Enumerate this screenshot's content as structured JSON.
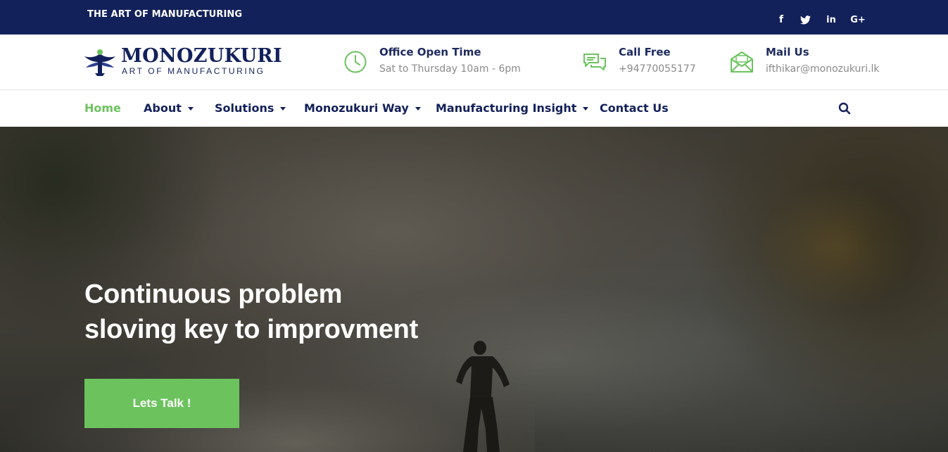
{
  "topbar": {
    "title": "THE ART OF MANUFACTURING",
    "social": [
      {
        "icon": "facebook-icon",
        "glyph": "f"
      },
      {
        "icon": "twitter-icon",
        "glyph": ""
      },
      {
        "icon": "linkedin-icon",
        "glyph": "in"
      },
      {
        "icon": "google-plus-icon",
        "glyph": "G+"
      }
    ]
  },
  "logo": {
    "name": "MONOZUKURI",
    "tagline": "ART OF MANUFACTURING"
  },
  "info": {
    "office": {
      "title": "Office Open Time",
      "sub": "Sat to Thursday 10am - 6pm",
      "icon": "clock-icon"
    },
    "call": {
      "title": "Call Free",
      "sub": "+94770055177",
      "icon": "chat-icon"
    },
    "mail": {
      "title": "Mail Us",
      "sub": "ifthikar@monozukuri.lk",
      "icon": "envelope-icon"
    }
  },
  "nav": {
    "items": [
      {
        "label": "Home",
        "active": true,
        "dropdown": false
      },
      {
        "label": "About",
        "active": false,
        "dropdown": true
      },
      {
        "label": "Solutions",
        "active": false,
        "dropdown": true
      },
      {
        "label": "Monozukuri Way",
        "active": false,
        "dropdown": true
      },
      {
        "label": "Manufacturing Insight",
        "active": false,
        "dropdown": true
      },
      {
        "label": "Contact Us",
        "active": false,
        "dropdown": false
      }
    ],
    "search_icon": "search-icon"
  },
  "hero": {
    "title_line1": "Continuous problem",
    "title_line2": "sloving key to improvment",
    "cta_label": "Lets Talk !"
  },
  "colors": {
    "navy": "#13215a",
    "accent_green": "#6cc35e",
    "muted_text": "#8a8a8a"
  }
}
